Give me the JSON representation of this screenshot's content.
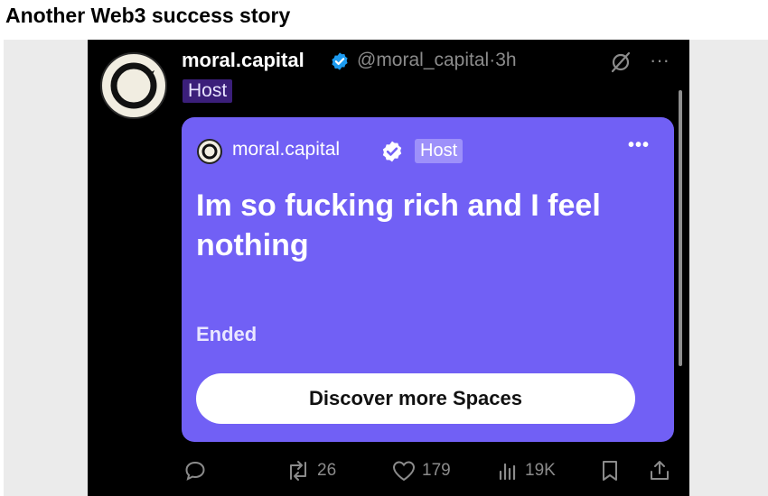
{
  "post": {
    "title": "Another Web3 success story"
  },
  "tweet": {
    "display_name": "moral.capital",
    "handle": "@moral_capital",
    "time": "·3h",
    "role_badge": "Host",
    "more_label": "···"
  },
  "space_card": {
    "host_name": "moral.capital",
    "host_badge": "Host",
    "more_label": "•••",
    "title": "Im so fucking rich and I feel nothing",
    "status": "Ended",
    "cta": "Discover more Spaces",
    "card_color": "#7160f5"
  },
  "actions": {
    "reply_count": "",
    "retweet_count": "26",
    "like_count": "179",
    "views_count": "19K"
  },
  "icons": [
    "verified-badge-icon",
    "grok-icon",
    "more-icon",
    "reply-icon",
    "retweet-icon",
    "like-icon",
    "views-icon",
    "bookmark-icon",
    "share-icon"
  ]
}
